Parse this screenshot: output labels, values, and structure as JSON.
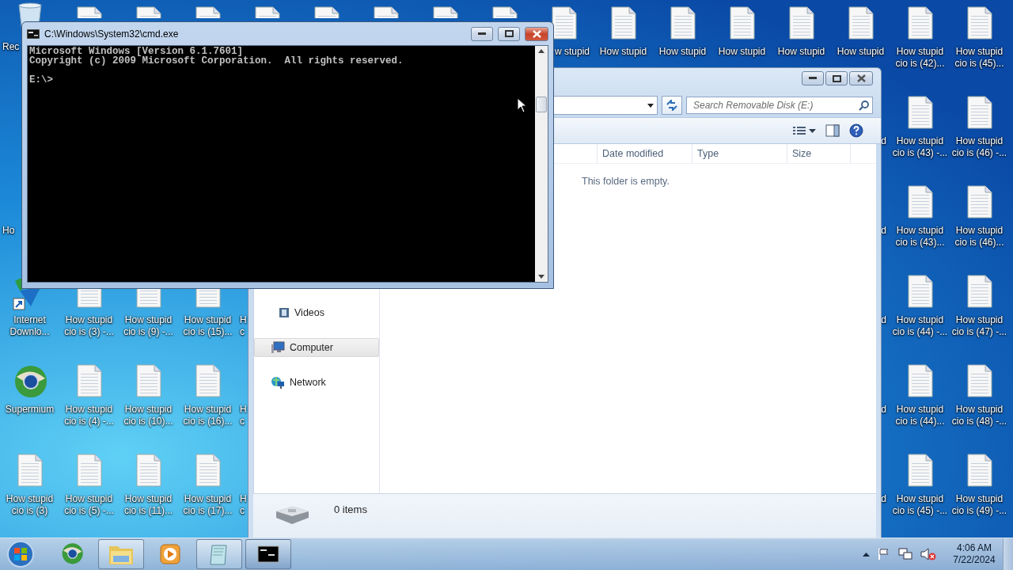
{
  "desktop_icons": [
    {
      "kind": "recycle",
      "label": [
        "Rec"
      ]
    },
    {
      "kind": "file"
    },
    {
      "kind": "file"
    },
    {
      "kind": "file"
    },
    {
      "kind": "file"
    },
    {
      "kind": "file"
    },
    {
      "kind": "file"
    },
    {
      "kind": "file"
    },
    {
      "kind": "file"
    },
    {
      "kind": "file",
      "label": [
        "w stupid"
      ]
    },
    {
      "kind": "file",
      "label": [
        "How stupid"
      ]
    },
    {
      "kind": "file",
      "label": [
        "How stupid"
      ]
    },
    {
      "kind": "file",
      "label": [
        "How stupid"
      ]
    },
    {
      "kind": "file",
      "label": [
        "How stupid"
      ]
    },
    {
      "kind": "file",
      "label": [
        "How stupid"
      ]
    },
    {
      "kind": "file",
      "label": [
        "How stupid",
        "cio is (42)..."
      ]
    },
    {
      "kind": "file",
      "label": [
        "How stupid",
        "cio is (45)..."
      ]
    },
    {
      "kind": "fragment",
      "label": [
        "d"
      ]
    },
    {
      "kind": "file",
      "label": [
        "How stupid",
        "cio is (43) -..."
      ]
    },
    {
      "kind": "file",
      "label": [
        "How stupid",
        "cio is (46) -..."
      ]
    },
    {
      "kind": "fragment",
      "label": [
        "Ho"
      ]
    },
    {
      "kind": "fragment",
      "label": [
        "d"
      ]
    },
    {
      "kind": "file",
      "label": [
        "How stupid",
        "cio is (43)..."
      ]
    },
    {
      "kind": "file",
      "label": [
        "How stupid",
        "cio is (46)..."
      ]
    },
    {
      "kind": "downloader",
      "label": [
        "Internet",
        "Downlo..."
      ]
    },
    {
      "kind": "file",
      "label": [
        "How stupid",
        "cio is (3) -..."
      ]
    },
    {
      "kind": "file",
      "label": [
        "How stupid",
        "cio is (9) -..."
      ]
    },
    {
      "kind": "file",
      "label": [
        "How stupid",
        "cio is (15)..."
      ]
    },
    {
      "kind": "fragment",
      "label": [
        "H",
        "c"
      ]
    },
    {
      "kind": "fragment",
      "label": [
        "d"
      ]
    },
    {
      "kind": "file",
      "label": [
        "How stupid",
        "cio is (44) -..."
      ]
    },
    {
      "kind": "file",
      "label": [
        "How stupid",
        "cio is (47) -..."
      ]
    },
    {
      "kind": "browser",
      "label": [
        "Supermium"
      ]
    },
    {
      "kind": "file",
      "label": [
        "How stupid",
        "cio is (4) -..."
      ]
    },
    {
      "kind": "file",
      "label": [
        "How stupid",
        "cio is (10)..."
      ]
    },
    {
      "kind": "file",
      "label": [
        "How stupid",
        "cio is (16)..."
      ]
    },
    {
      "kind": "fragment",
      "label": [
        "H",
        "c"
      ]
    },
    {
      "kind": "fragment",
      "label": [
        "d"
      ]
    },
    {
      "kind": "file",
      "label": [
        "How stupid",
        "cio is (44)..."
      ]
    },
    {
      "kind": "file",
      "label": [
        "How stupid",
        "cio is (48) -..."
      ]
    },
    {
      "kind": "file",
      "label": [
        "How stupid",
        "cio is (3)"
      ]
    },
    {
      "kind": "file",
      "label": [
        "How stupid",
        "cio is (5) -..."
      ]
    },
    {
      "kind": "file",
      "label": [
        "How stupid",
        "cio is (11)..."
      ]
    },
    {
      "kind": "file",
      "label": [
        "How stupid",
        "cio is (17)..."
      ]
    },
    {
      "kind": "fragment",
      "label": [
        "H",
        "c"
      ]
    },
    {
      "kind": "fragment",
      "label": [
        "d"
      ]
    },
    {
      "kind": "file",
      "label": [
        "How stupid",
        "cio is (45) -..."
      ]
    },
    {
      "kind": "file",
      "label": [
        "How stupid",
        "cio is (49) -..."
      ]
    }
  ],
  "explorer_window": {
    "search": {
      "placeholder": "Search Removable Disk (E:)"
    },
    "columns": [
      "Date modified",
      "Type",
      "Size"
    ],
    "empty_message": "This folder is empty.",
    "navigation": [
      {
        "kind": "library",
        "label": "Videos",
        "selected": false
      },
      {
        "kind": "computer",
        "label": "Computer",
        "selected": true
      },
      {
        "kind": "network",
        "label": "Network",
        "selected": false
      }
    ],
    "status": "0 items"
  },
  "command_window": {
    "title": "C:\\Windows\\System32\\cmd.exe",
    "output": [
      "Microsoft Windows [Version 6.1.7601]",
      "Copyright (c) 2009 Microsoft Corporation.  All rights reserved."
    ],
    "prompt": "E:\\>"
  },
  "taskbar": {
    "apps": [
      {
        "kind": "browser",
        "open": false,
        "selected": false
      },
      {
        "kind": "folder",
        "open": true,
        "selected": false
      },
      {
        "kind": "media",
        "open": false,
        "selected": false
      },
      {
        "kind": "notepad",
        "open": true,
        "selected": false
      },
      {
        "kind": "console",
        "open": true,
        "selected": true
      }
    ],
    "clock": {
      "time": "4:06 AM",
      "date": "7/22/2024"
    }
  }
}
